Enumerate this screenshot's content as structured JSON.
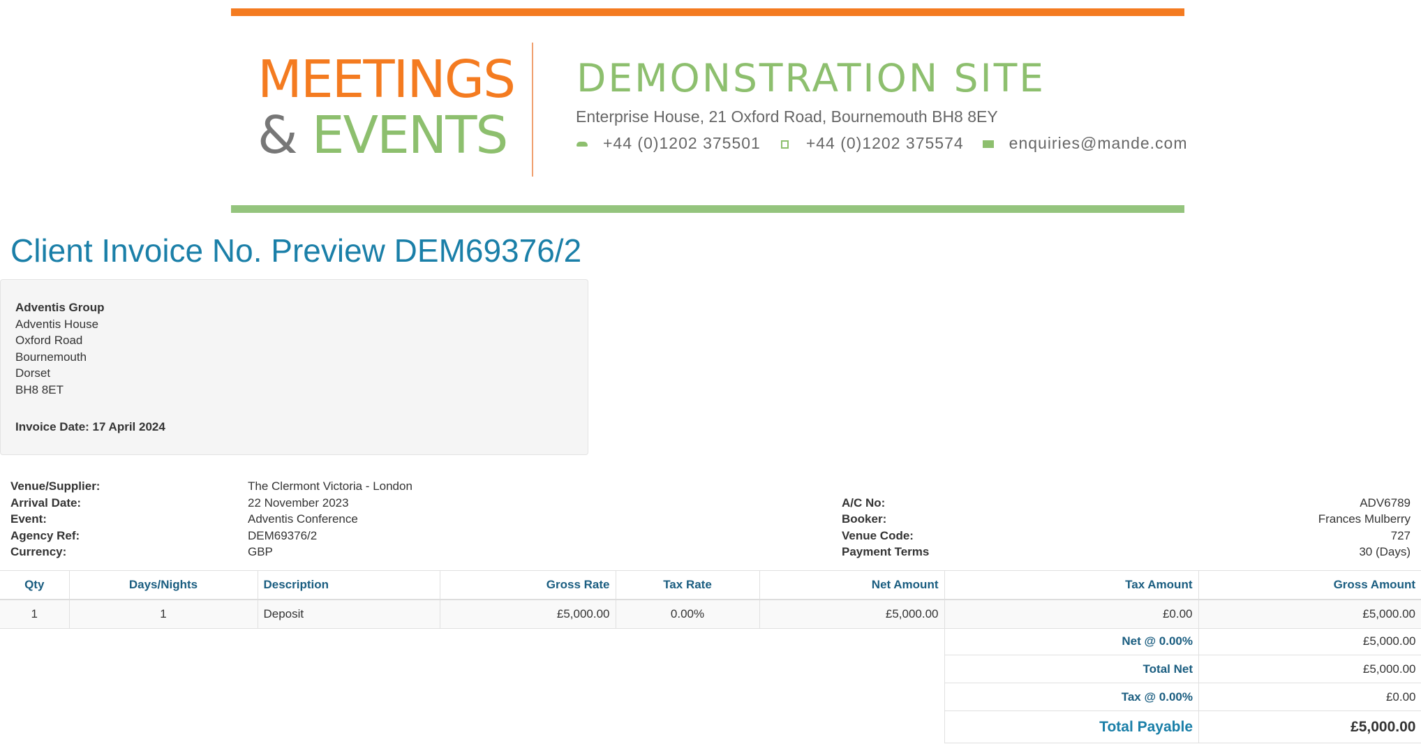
{
  "banner": {
    "logo_line1": "MEETINGS",
    "logo_amp": "&",
    "logo_line2": "EVENTS",
    "site_title": "DEMONSTRATION SITE",
    "address": "Enterprise House, 21 Oxford Road, Bournemouth BH8 8EY",
    "phone": "+44 (0)1202 375501",
    "fax": "+44 (0)1202 375574",
    "email": "enquiries@mande.com",
    "colors": {
      "orange": "#f47b20",
      "green": "#8dbf6e",
      "grey": "#777777"
    }
  },
  "heading": "Client Invoice No. Preview DEM69376/2",
  "client": {
    "name": "Adventis Group",
    "address_lines": [
      "Adventis House",
      "Oxford Road",
      "Bournemouth",
      "Dorset",
      "BH8 8ET"
    ],
    "invoice_date_label": "Invoice Date:",
    "invoice_date": "17 April 2024"
  },
  "details_left": [
    {
      "label": "Venue/Supplier:",
      "value": "The Clermont Victoria - London"
    },
    {
      "label": "Arrival Date:",
      "value": "22 November 2023"
    },
    {
      "label": "Event:",
      "value": "Adventis Conference"
    },
    {
      "label": "Agency Ref:",
      "value": "DEM69376/2"
    },
    {
      "label": "Currency:",
      "value": "GBP"
    }
  ],
  "details_right": [
    {
      "label": "A/C No:",
      "value": "ADV6789"
    },
    {
      "label": "Booker:",
      "value": "Frances Mulberry"
    },
    {
      "label": "Venue Code:",
      "value": "727"
    },
    {
      "label": "Payment Terms",
      "value": "30 (Days)"
    }
  ],
  "table": {
    "columns": [
      "Qty",
      "Days/Nights",
      "Description",
      "Gross Rate",
      "Tax Rate",
      "Net Amount",
      "Tax Amount",
      "Gross Amount"
    ],
    "rows": [
      [
        "1",
        "1",
        "Deposit",
        "£5,000.00",
        "0.00%",
        "£5,000.00",
        "£0.00",
        "£5,000.00"
      ]
    ]
  },
  "totals": [
    {
      "label": "Net @ 0.00%",
      "value": "£5,000.00"
    },
    {
      "label": "Total Net",
      "value": "£5,000.00"
    },
    {
      "label": "Tax @ 0.00%",
      "value": "£0.00"
    },
    {
      "label": "Total Payable",
      "value": "£5,000.00"
    }
  ]
}
